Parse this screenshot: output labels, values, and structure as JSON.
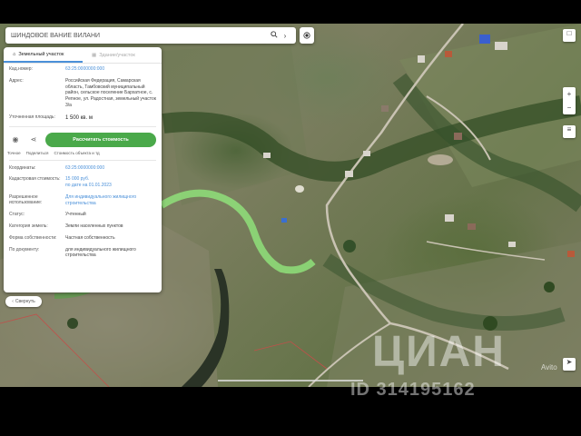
{
  "search": {
    "value": "ШИНДОВОЕ ВАНИЕ ВИЛАНИ",
    "search_icon": "search-icon",
    "close_icon": "chevron-right-icon"
  },
  "locate_icon": "crosshair-icon",
  "panel": {
    "tabs": [
      {
        "label": "Земельный участок",
        "icon": "land-icon"
      },
      {
        "label": "Здание/участок",
        "icon": "building-icon"
      }
    ],
    "info_rows": [
      {
        "label": "Кад.номер:",
        "value": "63:25:0000000:000",
        "style": "link"
      },
      {
        "label": "Адрес:",
        "value": "Российская Федерация, Самарская область, Тамбовский муниципальный район, сельское поселение Бархатное, с. Репное, ул. Радостная, земельный участок 3/а",
        "style": "normal"
      },
      {
        "label": "Уточненная площадь:",
        "value": "1 500 кв. м",
        "style": "big"
      }
    ],
    "actions": {
      "icons": [
        "location-icon",
        "share-icon"
      ],
      "labels": [
        "Точное",
        "Поделиться",
        "Стоимость объекта и тд"
      ],
      "green_button": "Рассчитать стоимость"
    },
    "details": [
      {
        "label": "Координаты:",
        "value": "63:25:0000000:000",
        "style": "link"
      },
      {
        "label": "Кадастровая стоимость:",
        "value": "15 000 руб.\nпо дате на 01.01.2023",
        "style": "link"
      },
      {
        "label": "Разрешенное использование:",
        "value": "Для индивидуального жилищного строительства",
        "style": "link"
      },
      {
        "label": "Статус:",
        "value": "Учтенный",
        "style": "normal"
      },
      {
        "label": "Категория земель:",
        "value": "Земли населенных пунктов",
        "style": "normal"
      },
      {
        "label": "Форма собственности:",
        "value": "Частная собственность",
        "style": "normal"
      },
      {
        "label": "По документу:",
        "value": "для индивидуального жилищного строительства",
        "style": "normal"
      }
    ]
  },
  "collapse_button": "Свернуть",
  "map_controls": {
    "zoom_in": "+",
    "zoom_out": "−",
    "layers_icon": "layers-icon",
    "compass_icon": "compass-icon"
  },
  "watermark": {
    "brand": "ЦИАН",
    "id_text": "ID 314195162"
  },
  "avito_label": "Avito"
}
